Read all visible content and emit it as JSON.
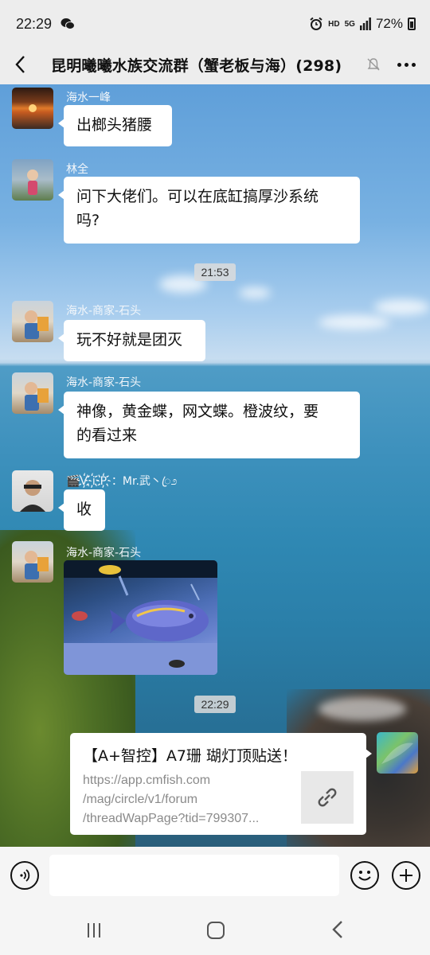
{
  "status": {
    "time": "22:29",
    "hd": "HD",
    "network": "5G",
    "battery": "72%"
  },
  "header": {
    "title": "昆明曦曦水族交流群（蟹老板与海）(298)"
  },
  "messages": [
    {
      "sender": "海水一峰",
      "text": "出榔头猪腰"
    },
    {
      "sender": "林全",
      "text_line1": "问下大佬们。可以在底缸搞厚沙系统",
      "text_line2": "吗?"
    },
    {
      "sender": "海水-商家-石头",
      "text": "玩不好就是团灭"
    },
    {
      "sender": "海水-商家-石头",
      "text_line1": "神像，黄金蝶，网文蝶。橙波纹，要",
      "text_line2": "的看过来"
    },
    {
      "sender": "🎬V҉i҉P҉：Mr.武丶ꦿ೨",
      "text": "收"
    },
    {
      "sender": "海水-商家-石头",
      "type": "image"
    }
  ],
  "timestamps": [
    "21:53",
    "22:29"
  ],
  "link_card": {
    "title": "【A+智控】A7珊 瑚灯顶贴送！",
    "url_line1": "https://app.cmfish.com",
    "url_line2": "/mag/circle/v1/forum",
    "url_line3": "/threadWapPage?tid=799307..."
  },
  "icons": {
    "back": "back-arrow-icon",
    "mute": "mute-bell-icon",
    "more": "more-dots-icon",
    "voice": "voice-icon",
    "emoji": "emoji-icon",
    "plus": "plus-icon",
    "link": "link-icon"
  },
  "colors": {
    "bubble": "#ffffff",
    "header_bg": "#ededed",
    "input_bg": "#f5f5f5"
  }
}
